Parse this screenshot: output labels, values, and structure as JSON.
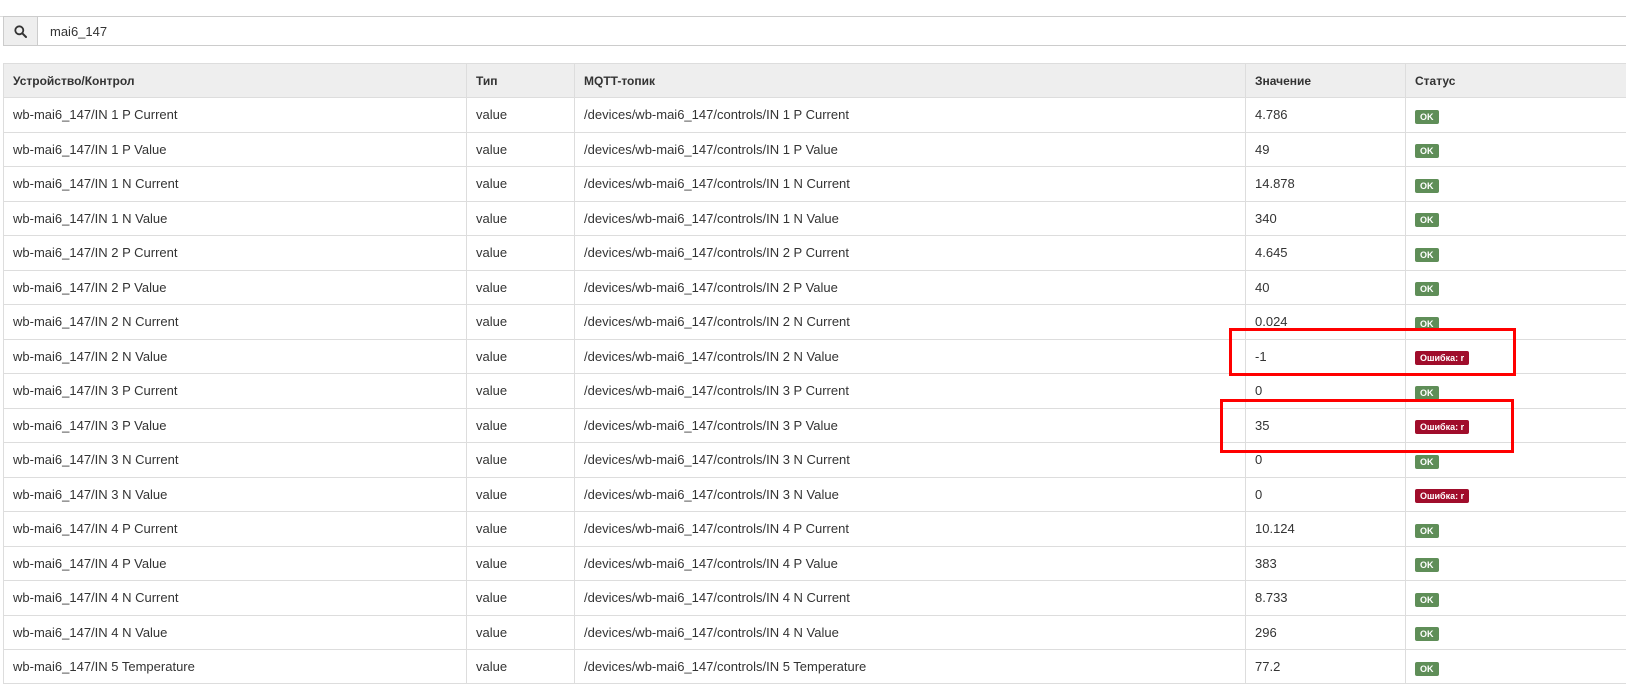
{
  "search": {
    "value": "mai6_147",
    "icon": "search-icon"
  },
  "table": {
    "headers": [
      "Устройство/Контрол",
      "Тип",
      "MQTT-топик",
      "Значение",
      "Статус"
    ],
    "rows": [
      {
        "control": "wb-mai6_147/IN 1 P Current",
        "type": "value",
        "topic": "/devices/wb-mai6_147/controls/IN 1 P Current",
        "value": "4.786",
        "status": "OK",
        "state": "ok"
      },
      {
        "control": "wb-mai6_147/IN 1 P Value",
        "type": "value",
        "topic": "/devices/wb-mai6_147/controls/IN 1 P Value",
        "value": "49",
        "status": "OK",
        "state": "ok"
      },
      {
        "control": "wb-mai6_147/IN 1 N Current",
        "type": "value",
        "topic": "/devices/wb-mai6_147/controls/IN 1 N Current",
        "value": "14.878",
        "status": "OK",
        "state": "ok"
      },
      {
        "control": "wb-mai6_147/IN 1 N Value",
        "type": "value",
        "topic": "/devices/wb-mai6_147/controls/IN 1 N Value",
        "value": "340",
        "status": "OK",
        "state": "ok"
      },
      {
        "control": "wb-mai6_147/IN 2 P Current",
        "type": "value",
        "topic": "/devices/wb-mai6_147/controls/IN 2 P Current",
        "value": "4.645",
        "status": "OK",
        "state": "ok"
      },
      {
        "control": "wb-mai6_147/IN 2 P Value",
        "type": "value",
        "topic": "/devices/wb-mai6_147/controls/IN 2 P Value",
        "value": "40",
        "status": "OK",
        "state": "ok"
      },
      {
        "control": "wb-mai6_147/IN 2 N Current",
        "type": "value",
        "topic": "/devices/wb-mai6_147/controls/IN 2 N Current",
        "value": "0.024",
        "status": "OK",
        "state": "ok"
      },
      {
        "control": "wb-mai6_147/IN 2 N Value",
        "type": "value",
        "topic": "/devices/wb-mai6_147/controls/IN 2 N Value",
        "value": "-1",
        "status": "Ошибка: r",
        "state": "err"
      },
      {
        "control": "wb-mai6_147/IN 3 P Current",
        "type": "value",
        "topic": "/devices/wb-mai6_147/controls/IN 3 P Current",
        "value": "0",
        "status": "OK",
        "state": "ok"
      },
      {
        "control": "wb-mai6_147/IN 3 P Value",
        "type": "value",
        "topic": "/devices/wb-mai6_147/controls/IN 3 P Value",
        "value": "35",
        "status": "Ошибка: r",
        "state": "err"
      },
      {
        "control": "wb-mai6_147/IN 3 N Current",
        "type": "value",
        "topic": "/devices/wb-mai6_147/controls/IN 3 N Current",
        "value": "0",
        "status": "OK",
        "state": "ok"
      },
      {
        "control": "wb-mai6_147/IN 3 N Value",
        "type": "value",
        "topic": "/devices/wb-mai6_147/controls/IN 3 N Value",
        "value": "0",
        "status": "Ошибка: r",
        "state": "err"
      },
      {
        "control": "wb-mai6_147/IN 4 P Current",
        "type": "value",
        "topic": "/devices/wb-mai6_147/controls/IN 4 P Current",
        "value": "10.124",
        "status": "OK",
        "state": "ok"
      },
      {
        "control": "wb-mai6_147/IN 4 P Value",
        "type": "value",
        "topic": "/devices/wb-mai6_147/controls/IN 4 P Value",
        "value": "383",
        "status": "OK",
        "state": "ok"
      },
      {
        "control": "wb-mai6_147/IN 4 N Current",
        "type": "value",
        "topic": "/devices/wb-mai6_147/controls/IN 4 N Current",
        "value": "8.733",
        "status": "OK",
        "state": "ok"
      },
      {
        "control": "wb-mai6_147/IN 4 N Value",
        "type": "value",
        "topic": "/devices/wb-mai6_147/controls/IN 4 N Value",
        "value": "296",
        "status": "OK",
        "state": "ok"
      },
      {
        "control": "wb-mai6_147/IN 5 Temperature",
        "type": "value",
        "topic": "/devices/wb-mai6_147/controls/IN 5 Temperature",
        "value": "77.2",
        "status": "OK",
        "state": "ok"
      }
    ]
  },
  "colors": {
    "ok": "#5f8e58",
    "error": "#a00d2b",
    "highlight": "#ff0000"
  }
}
